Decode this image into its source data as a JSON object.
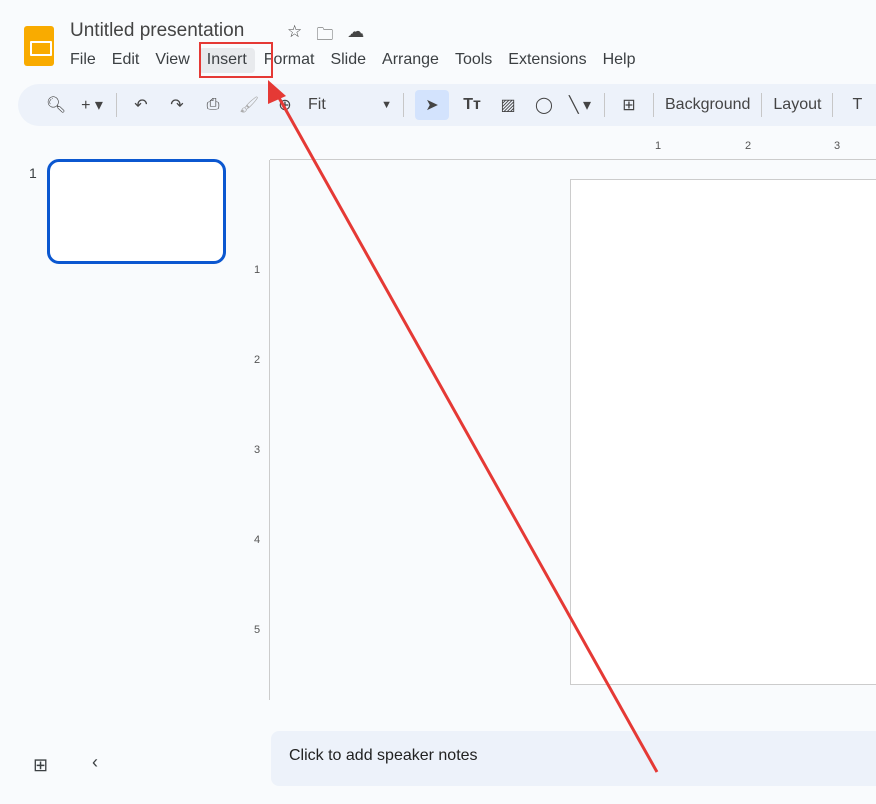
{
  "app": {
    "title": "Untitled presentation",
    "icons": [
      "star-icon",
      "move-to-folder-icon",
      "cloud-saved-icon"
    ]
  },
  "menu": [
    "File",
    "Edit",
    "View",
    "Insert",
    "Format",
    "Slide",
    "Arrange",
    "Tools",
    "Extensions",
    "Help"
  ],
  "highlighted_menu": "Insert",
  "toolbar": {
    "zoom": "Fit",
    "background": "Background",
    "layout": "Layout",
    "theme": "T"
  },
  "slides": [
    {
      "number": "1"
    }
  ],
  "ruler": {
    "h": [
      "1",
      "2",
      "3"
    ],
    "v": [
      "1",
      "2",
      "3",
      "4",
      "5"
    ]
  },
  "notes": {
    "placeholder": "Click to add speaker notes"
  },
  "annotation": {
    "color": "#e53935"
  }
}
